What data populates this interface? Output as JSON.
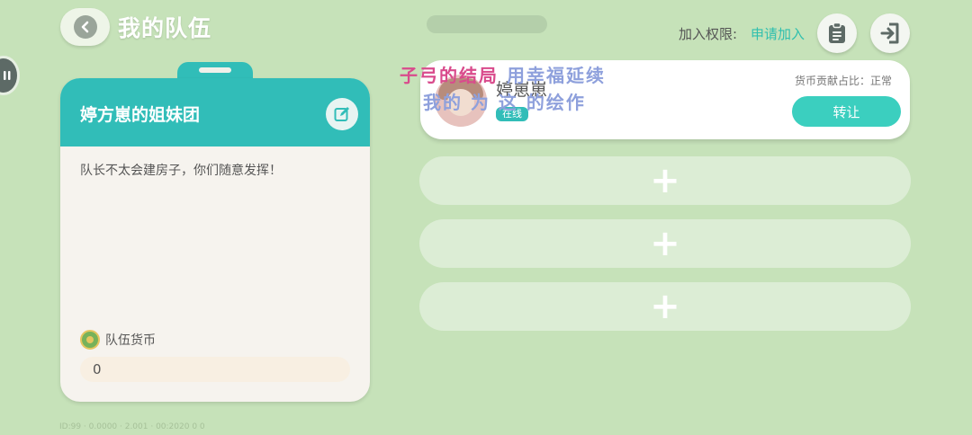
{
  "header": {
    "title": "我的队伍",
    "permission_label": "加入权限:",
    "permission_value": "申请加入"
  },
  "icons": {
    "back": "chevron-left-icon",
    "clipboard": "clipboard-icon",
    "exit": "exit-door-icon",
    "edit": "edit-pencil-icon",
    "coin": "coin-icon",
    "plus": "plus-icon"
  },
  "team": {
    "name": "婷方崽的姐妹团",
    "description": "队长不太会建房子，你们随意发挥！",
    "currency_label": "队伍货币",
    "currency_value": "0"
  },
  "members": [
    {
      "name": "婷崽崽",
      "status": "在线",
      "contribution_label": "货币贡献占比：正常",
      "action_label": "转让"
    }
  ],
  "empty_slots": [
    {
      "symbol": "+"
    },
    {
      "symbol": "+"
    },
    {
      "symbol": "+"
    }
  ],
  "overlay": {
    "line1_a": "子弓的结局",
    "line1_b": "用幸福延续",
    "line2": "我的 为 这 的绘作"
  },
  "footer": {
    "text": "ID:99 · 0.0000 · 2.001 · 00:2020 0 0"
  },
  "colors": {
    "background": "#c6e2b9",
    "accent": "#31bdb8",
    "button": "#3bcfbf",
    "permission_value": "#2fbfae"
  }
}
